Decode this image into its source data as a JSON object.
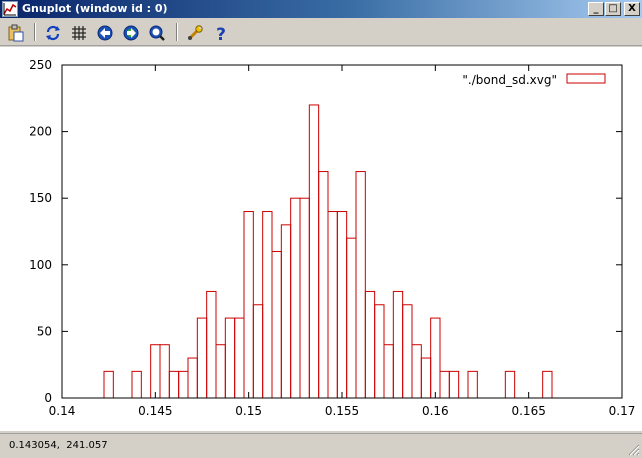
{
  "window": {
    "title": "Gnuplot (window id : 0)",
    "controls": {
      "minimize": "_",
      "maximize": "□",
      "close": "X"
    }
  },
  "toolbar": {
    "items": [
      {
        "icon": "clipboard-icon"
      },
      {
        "icon": "replot-icon"
      },
      {
        "icon": "grid-icon"
      },
      {
        "icon": "previous-zoom-icon"
      },
      {
        "icon": "next-zoom-icon"
      },
      {
        "icon": "autoscale-icon"
      },
      {
        "icon": "options-wrench-icon"
      },
      {
        "icon": "help-icon"
      }
    ]
  },
  "status": {
    "coordinates": "0.143054,  241.057"
  },
  "chart_data": {
    "type": "histogram",
    "color": "#cc0000",
    "bin_width": 0.0005,
    "xlim": [
      0.14,
      0.17
    ],
    "ylim": [
      0,
      250
    ],
    "x_ticks": [
      "0.14",
      "0.145",
      "0.15",
      "0.155",
      "0.16",
      "0.165",
      "0.17"
    ],
    "y_ticks": [
      "0",
      "50",
      "100",
      "150",
      "200",
      "250"
    ],
    "legend": {
      "label": "\"./bond_sd.xvg\"",
      "position": "top-right"
    },
    "series": [
      {
        "name": "\"./bond_sd.xvg\"",
        "x": [
          0.1425,
          0.144,
          0.145,
          0.1455,
          0.146,
          0.1465,
          0.147,
          0.1475,
          0.148,
          0.1485,
          0.149,
          0.1495,
          0.15,
          0.1505,
          0.151,
          0.1515,
          0.152,
          0.1525,
          0.153,
          0.1535,
          0.154,
          0.1545,
          0.155,
          0.1555,
          0.156,
          0.1565,
          0.157,
          0.1575,
          0.158,
          0.1585,
          0.159,
          0.1595,
          0.16,
          0.1605,
          0.161,
          0.1615,
          0.162,
          0.1625,
          0.163,
          0.1635,
          0.164,
          0.1645,
          0.165,
          0.1655,
          0.166
        ],
        "y": [
          20,
          20,
          40,
          40,
          20,
          20,
          30,
          60,
          80,
          40,
          60,
          60,
          140,
          70,
          140,
          110,
          130,
          150,
          150,
          220,
          170,
          140,
          140,
          120,
          170,
          80,
          70,
          40,
          80,
          70,
          40,
          30,
          60,
          20,
          20,
          0,
          20,
          0,
          0,
          0,
          20,
          0,
          0,
          0,
          20
        ]
      }
    ]
  }
}
